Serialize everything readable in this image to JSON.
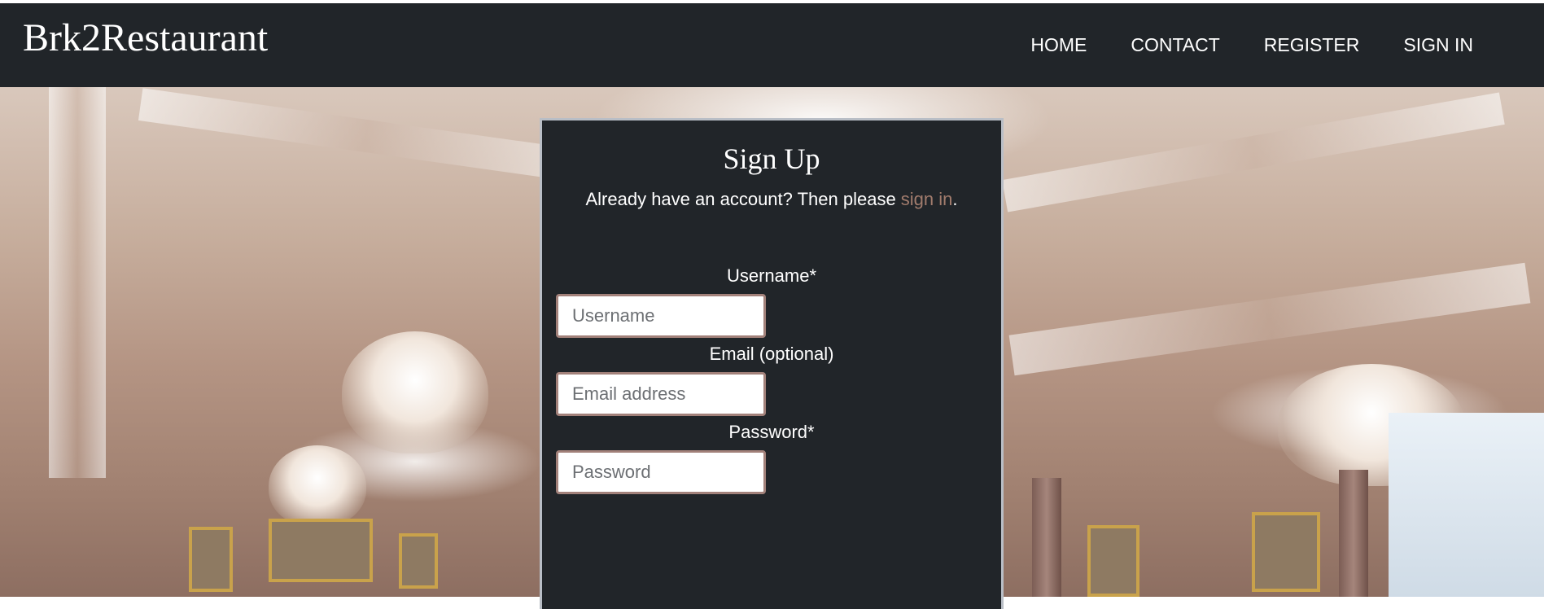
{
  "navbar": {
    "brand": "Brk2Restaurant",
    "links": [
      {
        "label": "HOME"
      },
      {
        "label": "CONTACT"
      },
      {
        "label": "REGISTER"
      },
      {
        "label": "SIGN IN"
      }
    ]
  },
  "signup": {
    "title": "Sign Up",
    "lead_text": "Already have an account? Then please ",
    "lead_link": "sign in",
    "lead_end": ".",
    "username_label": "Username*",
    "username_placeholder": "Username",
    "email_label": "Email (optional)",
    "email_placeholder": "Email address",
    "password_label": "Password*",
    "password_placeholder": "Password"
  },
  "colors": {
    "navbar_bg": "#212529",
    "link_accent": "#a27c6d",
    "input_border": "#a2817a"
  }
}
